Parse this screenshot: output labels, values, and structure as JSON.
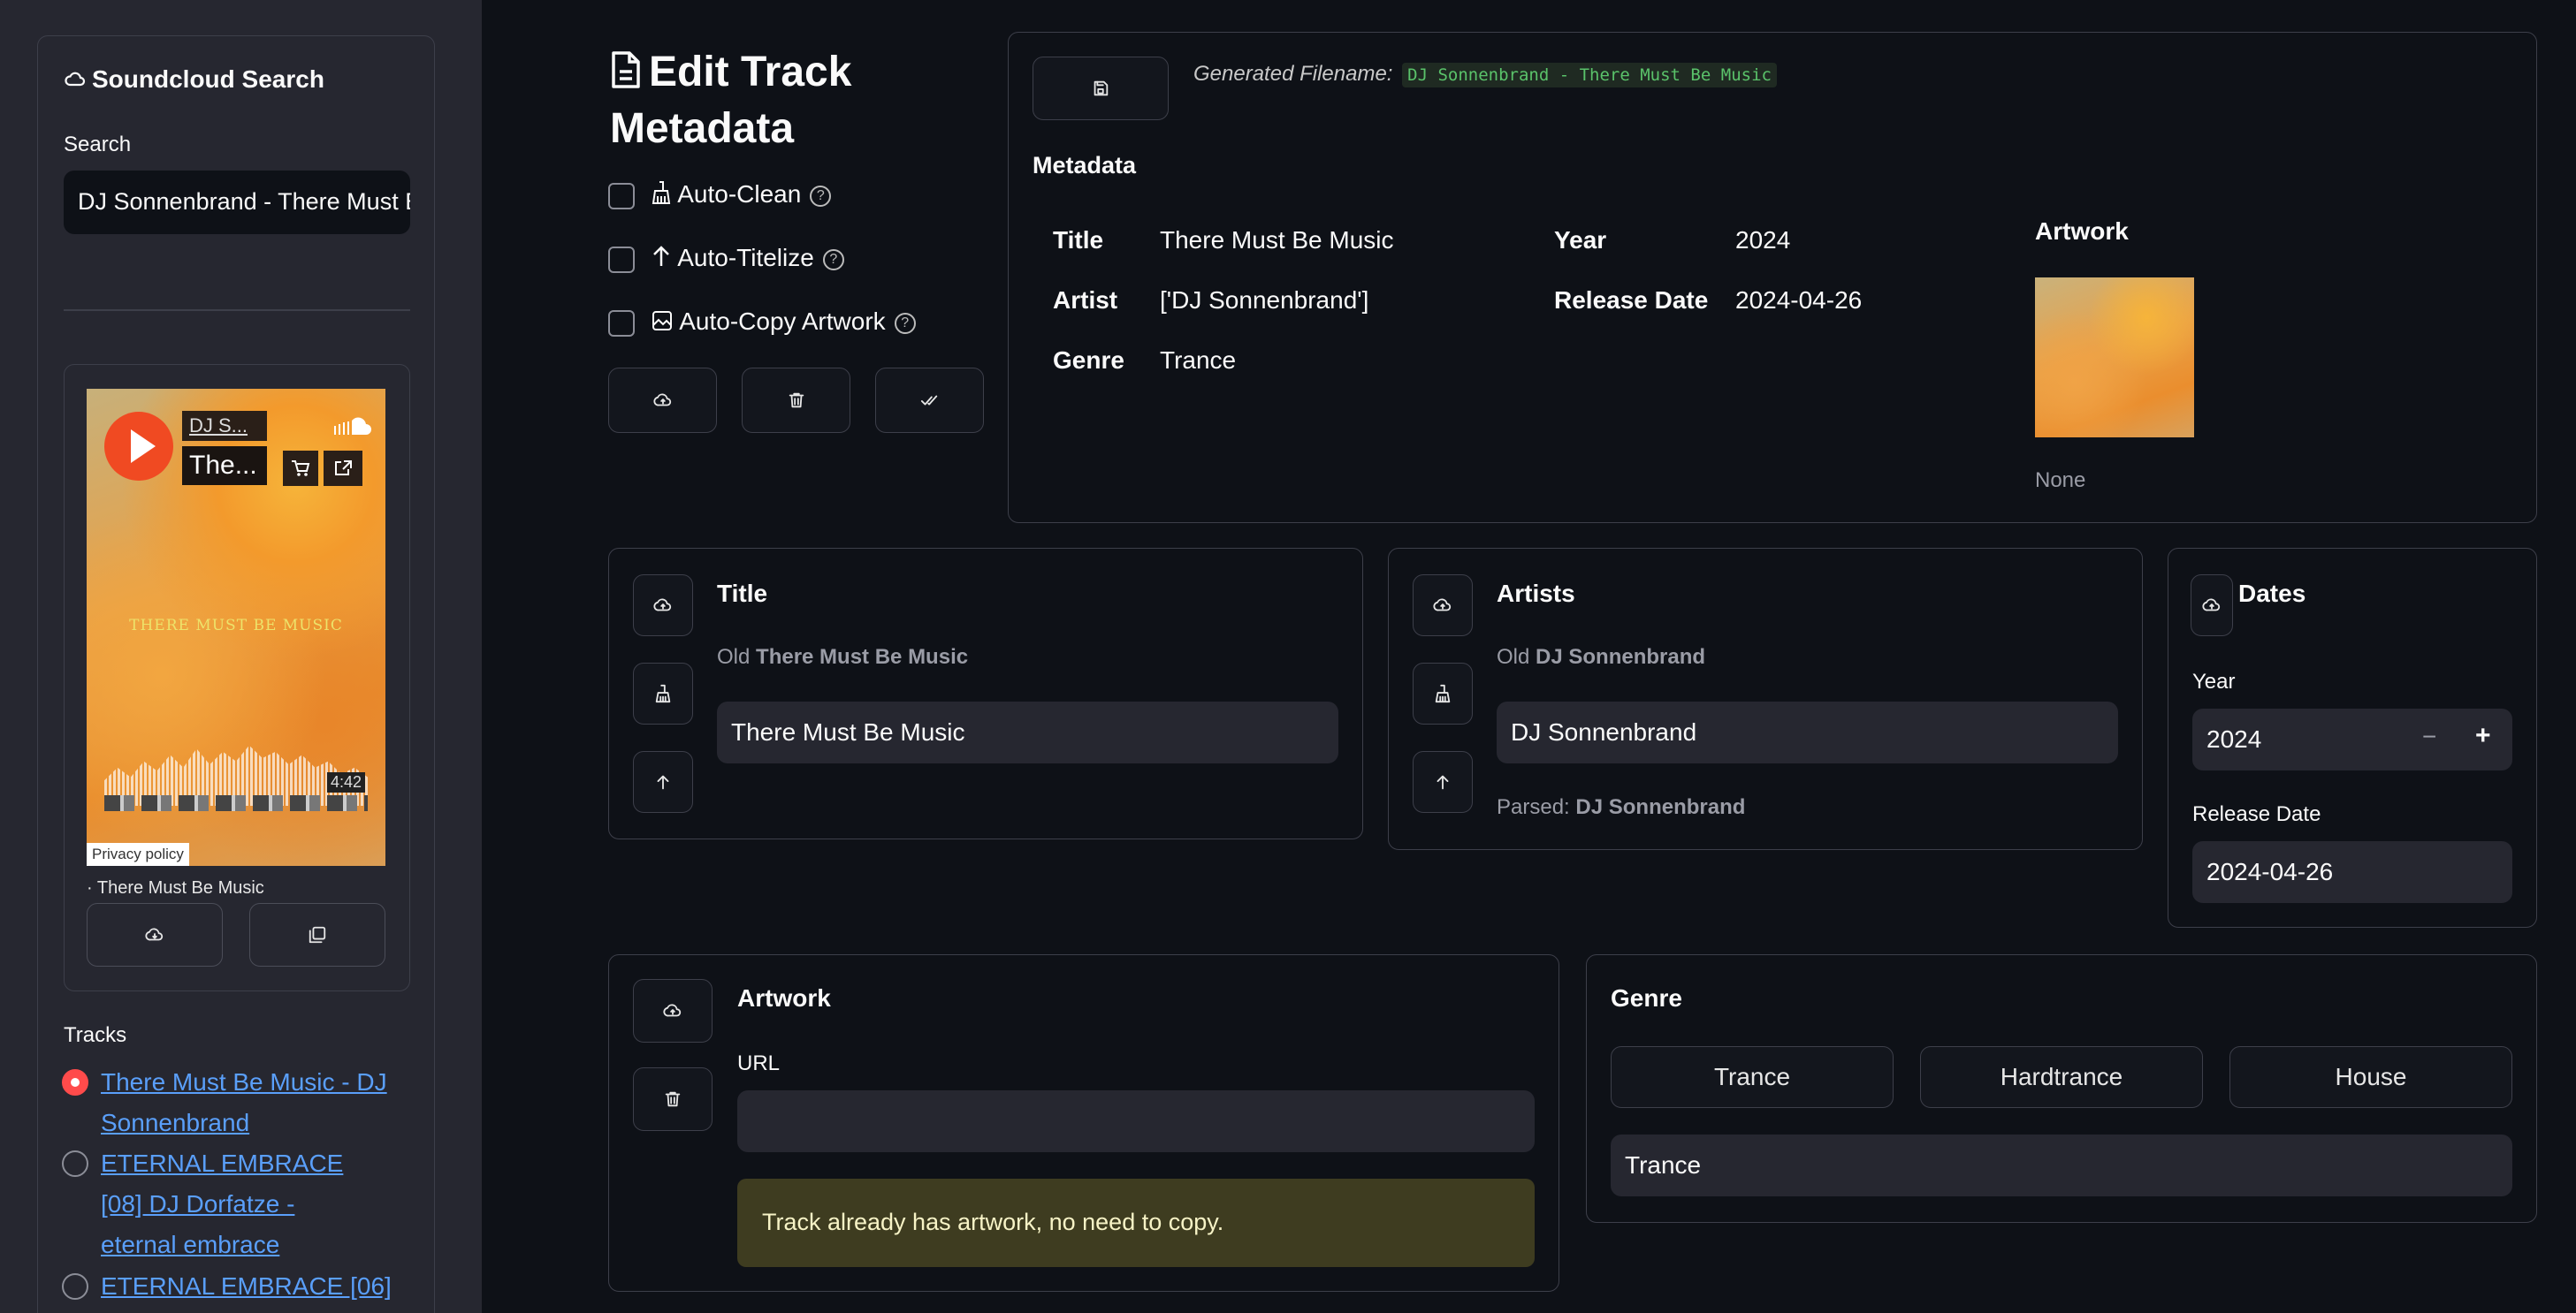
{
  "sidebar": {
    "title": "Soundcloud Search",
    "search_label": "Search",
    "search_value": "DJ Sonnenbrand - There Must Be Music",
    "player": {
      "artist_short": "DJ S...",
      "title_short": "The...",
      "art_text": "THERE MUST BE MUSIC",
      "duration": "4:42",
      "privacy": "Privacy policy",
      "caption": "· There Must Be Music"
    },
    "tracks_label": "Tracks",
    "tracks": [
      {
        "label": "There Must Be Music - DJ Sonnenbrand",
        "selected": true
      },
      {
        "label": "ETERNAL EMBRACE [08] DJ Dorfatze - eternal embrace",
        "selected": false
      },
      {
        "label": "ETERNAL EMBRACE [06]",
        "selected": false
      }
    ]
  },
  "main": {
    "page_title": "Edit Track Metadata",
    "options": [
      {
        "label": "Auto-Clean",
        "icon": "broom-icon"
      },
      {
        "label": "Auto-Titelize",
        "icon": "arrow-up-icon"
      },
      {
        "label": "Auto-Copy Artwork",
        "icon": "image-copy-icon"
      }
    ],
    "filename_label": "Generated Filename:",
    "filename_value": "DJ Sonnenbrand - There Must Be Music",
    "metadata_heading": "Metadata",
    "metadata": {
      "title_label": "Title",
      "title_value": "There Must Be Music",
      "artist_label": "Artist",
      "artist_value": "['DJ Sonnenbrand']",
      "genre_label": "Genre",
      "genre_value": "Trance",
      "year_label": "Year",
      "year_value": "2024",
      "release_label": "Release Date",
      "release_value": "2024-04-26",
      "artwork_label": "Artwork",
      "artwork_caption": "None"
    },
    "title_card": {
      "heading": "Title",
      "old_prefix": "Old",
      "old_value": "There Must Be Music",
      "value": "There Must Be Music"
    },
    "artists_card": {
      "heading": "Artists",
      "old_prefix": "Old",
      "old_value": "DJ Sonnenbrand",
      "value": "DJ Sonnenbrand",
      "parsed_prefix": "Parsed:",
      "parsed_value": "DJ Sonnenbrand"
    },
    "dates_card": {
      "heading": "Dates",
      "year_label": "Year",
      "year_value": "2024",
      "release_label": "Release Date",
      "release_value": "2024-04-26",
      "minus": "−",
      "plus": "+"
    },
    "artwork_card": {
      "heading": "Artwork",
      "url_label": "URL",
      "url_value": "",
      "notice": "Track already has artwork, no need to copy."
    },
    "genre_card": {
      "heading": "Genre",
      "options": [
        "Trance",
        "Hardtrance",
        "House"
      ],
      "value": "Trance"
    }
  },
  "colors": {
    "accent": "#ff4b4b",
    "link": "#5a9ffa",
    "code_green": "#5ac26a",
    "warning_bg": "#3e3c20"
  }
}
